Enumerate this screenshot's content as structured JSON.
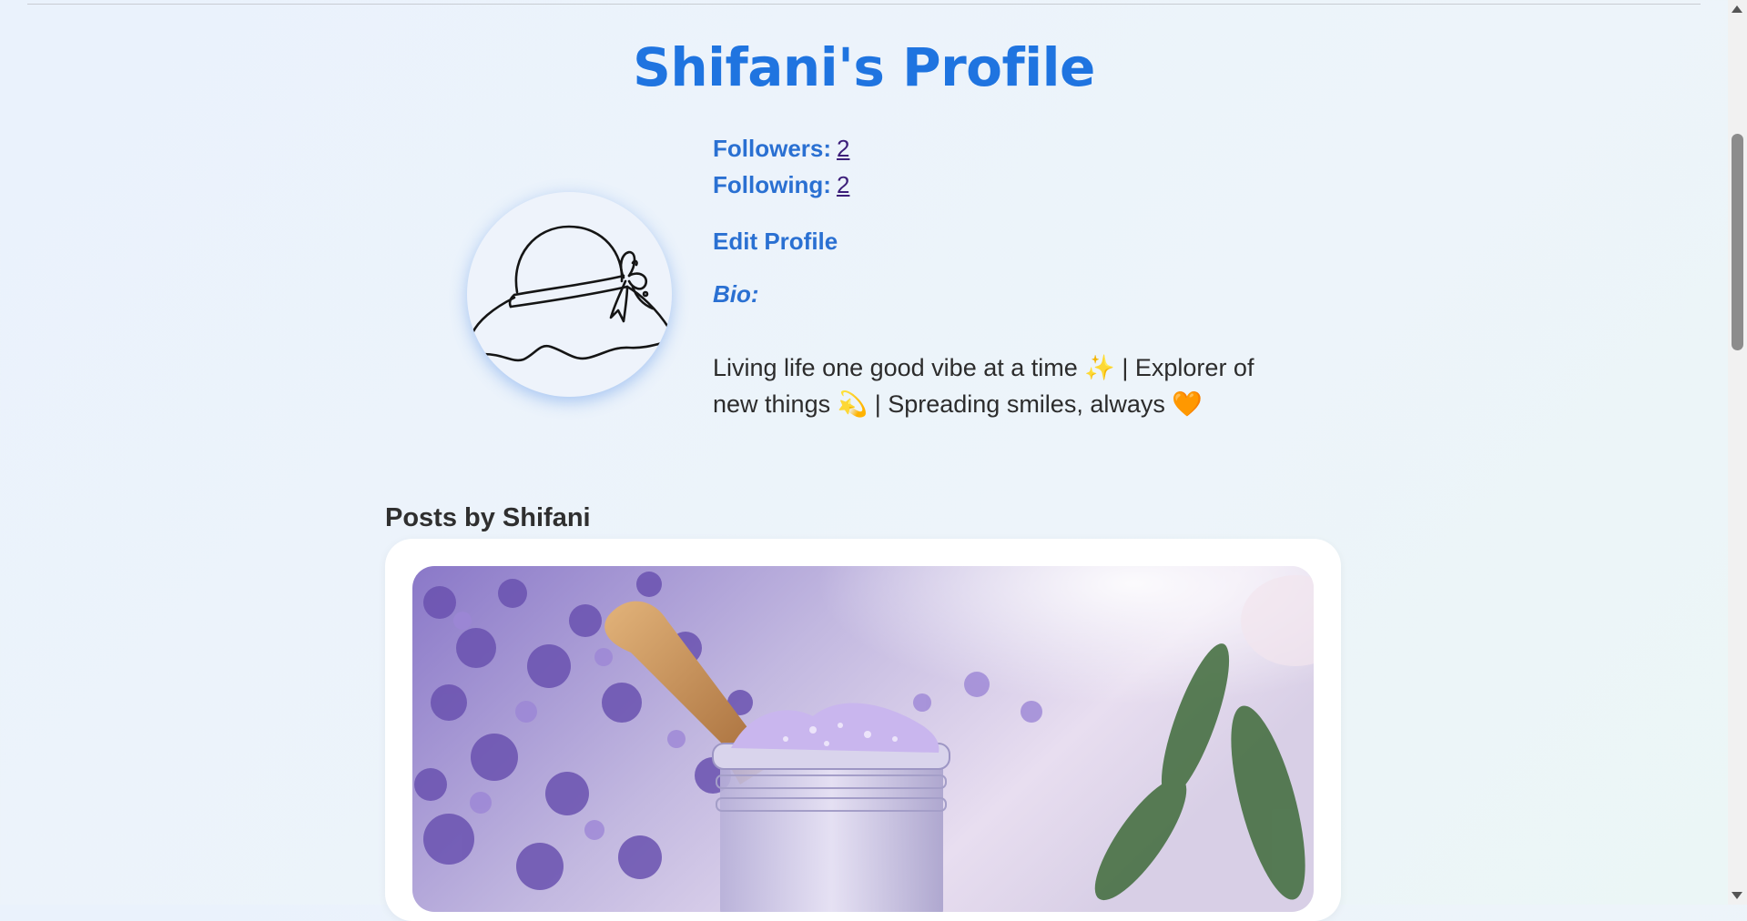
{
  "page": {
    "title": "Shifani's Profile"
  },
  "profile": {
    "avatar_icon": "sun-hat-icon",
    "followers_label": "Followers:",
    "followers_count": "2",
    "following_label": "Following:",
    "following_count": "2",
    "edit_label": "Edit Profile",
    "bio_label": "Bio:",
    "bio_text": "Living life one good vibe at a time ✨ | Explorer of new things 💫 | Spreading smiles, always 🧡"
  },
  "posts": {
    "heading": "Posts by Shifani",
    "items": [
      {
        "image": "lavender bath salt jar with wooden scoop"
      }
    ]
  },
  "colors": {
    "accent": "#1f74e0",
    "link": "#3d1f7a",
    "text": "#2c2c2c"
  }
}
